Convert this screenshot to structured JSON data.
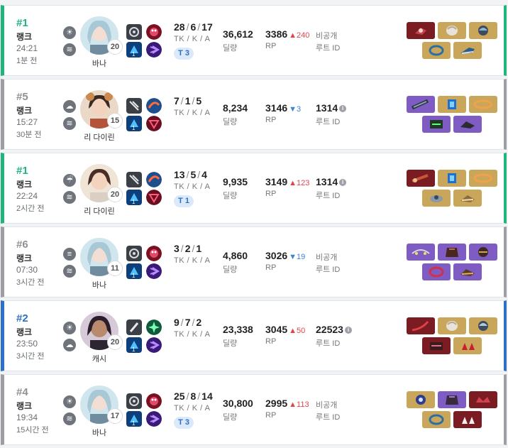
{
  "labels": {
    "kda": "TK / K / A",
    "damage": "딜량",
    "rp": "RP",
    "route": "루트 ID",
    "private_route": "비공개"
  },
  "colors": {
    "win": "#21b57d",
    "lose": "#9c9ea3",
    "top": "#2f6fc6",
    "rp_up": "#e0454d",
    "rp_down": "#3b83d6"
  },
  "matches": [
    {
      "rank": "#1",
      "mode": "랭크",
      "duration": "24:21",
      "ago": "1분 전",
      "weather1": "sun-icon",
      "weather2": "wind-icon",
      "character": "바나",
      "level": "20",
      "kda_tk": "28",
      "kda_k": "6",
      "kda_a": "17",
      "tier": "T 3",
      "damage": "36,612",
      "rp": "3386",
      "rp_delta": "▲240",
      "route": "",
      "route_private": true
    },
    {
      "rank": "#5",
      "mode": "랭크",
      "duration": "15:27",
      "ago": "30분 전",
      "weather1": "cloud-icon",
      "weather2": "wind-icon",
      "character": "리 다이린",
      "level": "15",
      "kda_tk": "7",
      "kda_k": "1",
      "kda_a": "5",
      "tier": "",
      "damage": "8,234",
      "rp": "3146",
      "rp_delta": "▼3",
      "route": "1314",
      "route_private": false
    },
    {
      "rank": "#1",
      "mode": "랭크",
      "duration": "22:24",
      "ago": "2시간 전",
      "weather1": "rain-icon",
      "weather2": "wind-icon",
      "character": "리 다이린",
      "level": "20",
      "kda_tk": "13",
      "kda_k": "5",
      "kda_a": "4",
      "tier": "T 1",
      "damage": "9,935",
      "rp": "3149",
      "rp_delta": "▲123",
      "route": "1314",
      "route_private": false
    },
    {
      "rank": "#6",
      "mode": "랭크",
      "duration": "07:30",
      "ago": "3시간 전",
      "weather1": "fog-icon",
      "weather2": "wind-icon",
      "character": "바나",
      "level": "11",
      "kda_tk": "3",
      "kda_k": "2",
      "kda_a": "1",
      "tier": "",
      "damage": "4,860",
      "rp": "3026",
      "rp_delta": "▼19",
      "route": "",
      "route_private": true
    },
    {
      "rank": "#2",
      "mode": "랭크",
      "duration": "23:50",
      "ago": "3시간 전",
      "weather1": "sun-icon",
      "weather2": "storm-icon",
      "character": "캐시",
      "level": "20",
      "kda_tk": "9",
      "kda_k": "7",
      "kda_a": "2",
      "tier": "",
      "damage": "23,338",
      "rp": "3045",
      "rp_delta": "▲50",
      "route": "22523",
      "route_private": false
    },
    {
      "rank": "#4",
      "mode": "랭크",
      "duration": "19:34",
      "ago": "15시간 전",
      "weather1": "sun-icon",
      "weather2": "wind-icon",
      "character": "바나",
      "level": "17",
      "kda_tk": "25",
      "kda_k": "8",
      "kda_a": "14",
      "tier": "T 3",
      "damage": "30,800",
      "rp": "2995",
      "rp_delta": "▲113",
      "route": "",
      "route_private": true
    }
  ]
}
